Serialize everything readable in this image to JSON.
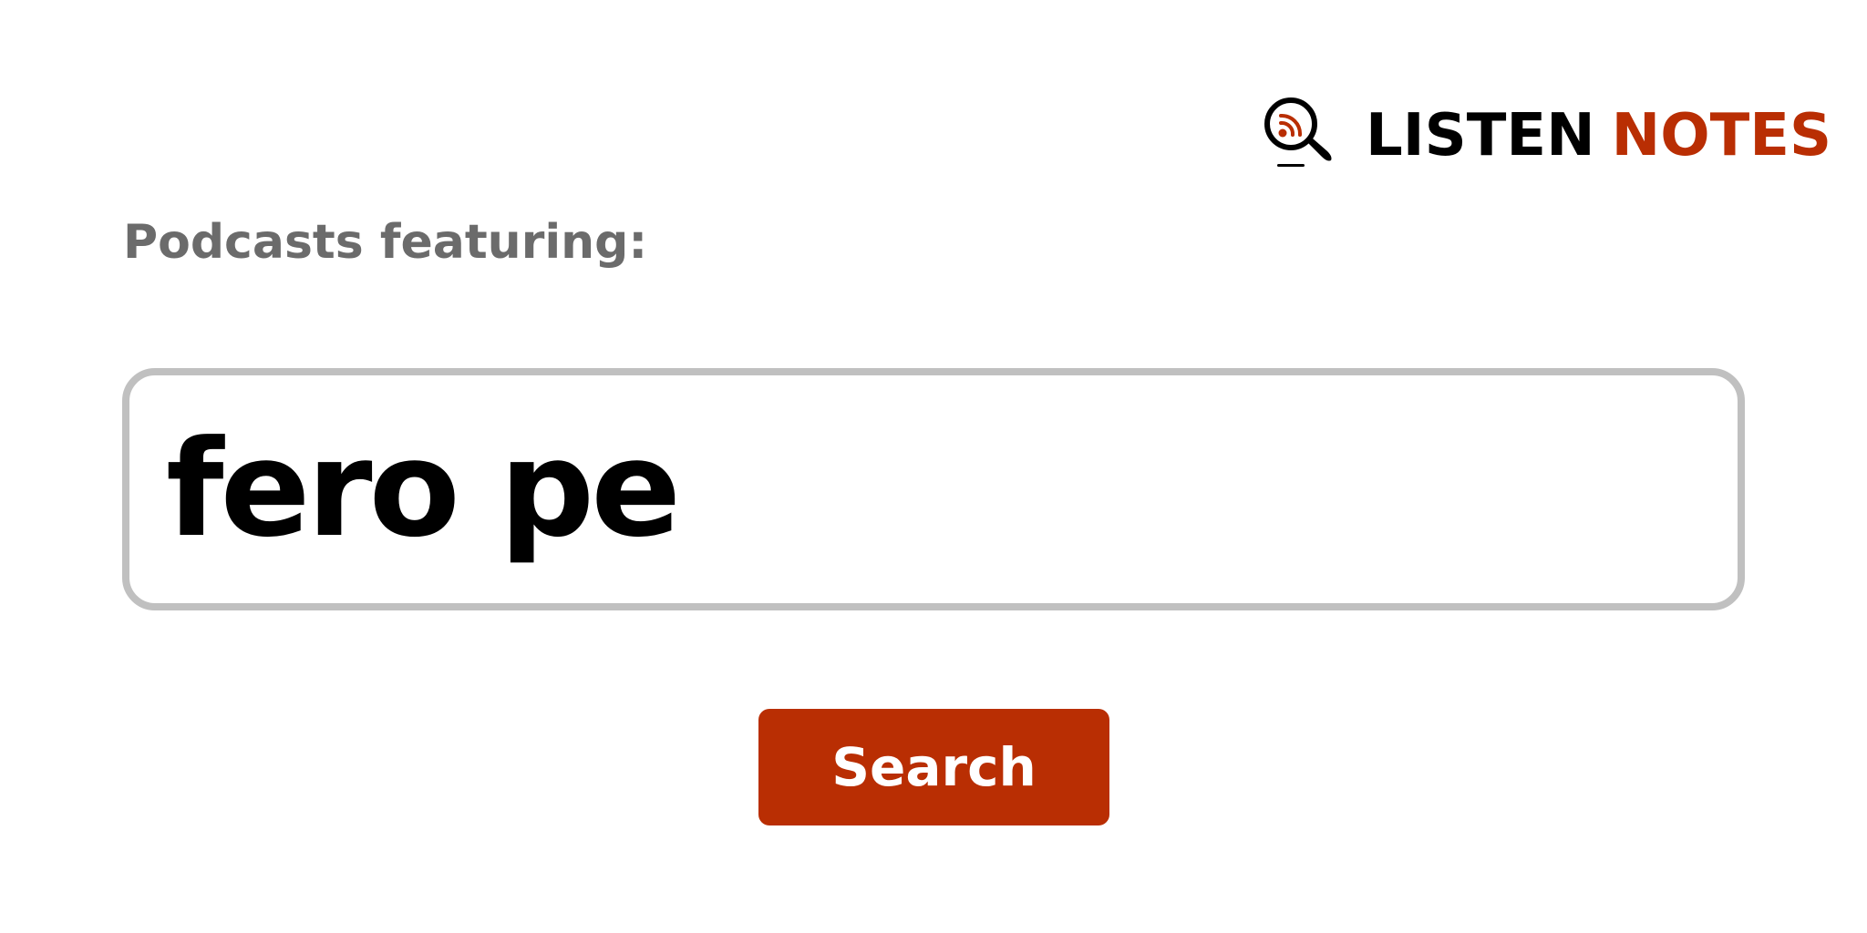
{
  "brand": {
    "word_1": "LISTEN",
    "word_2": "NOTES",
    "icon": "podcast-search-icon",
    "colors": {
      "primary": "#000000",
      "accent": "#b92e03"
    }
  },
  "heading": "Podcasts featuring:",
  "search": {
    "value": "fero pe",
    "border_color": "#c0c0c0"
  },
  "button": {
    "label": "Search",
    "color": "#b92e03",
    "text_color": "#ffffff"
  }
}
